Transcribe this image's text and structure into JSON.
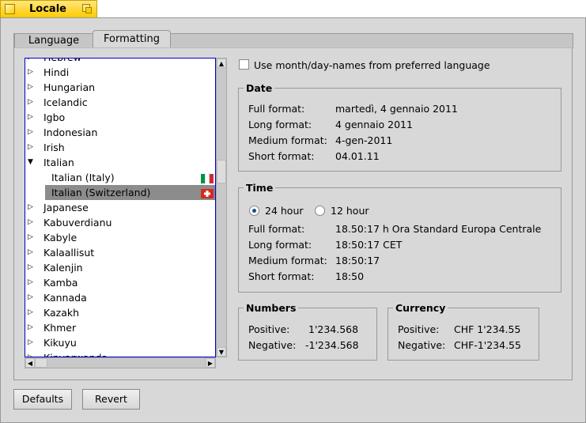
{
  "window": {
    "title": "Locale"
  },
  "tabs": [
    {
      "label": "Language"
    },
    {
      "label": "Formatting",
      "active": true
    }
  ],
  "language_list": [
    {
      "label": "Hebrew",
      "expanded": false
    },
    {
      "label": "Hindi",
      "expanded": false
    },
    {
      "label": "Hungarian",
      "expanded": false
    },
    {
      "label": "Icelandic",
      "expanded": false
    },
    {
      "label": "Igbo",
      "expanded": false
    },
    {
      "label": "Indonesian",
      "expanded": false
    },
    {
      "label": "Irish",
      "expanded": false
    },
    {
      "label": "Italian",
      "expanded": true
    },
    {
      "label": "Italian (Italy)",
      "child": true,
      "flag": "italy-flag"
    },
    {
      "label": "Italian (Switzerland)",
      "child": true,
      "flag": "switzerland-flag",
      "selected": true
    },
    {
      "label": "Japanese",
      "expanded": false
    },
    {
      "label": "Kabuverdianu",
      "expanded": false
    },
    {
      "label": "Kabyle",
      "expanded": false
    },
    {
      "label": "Kalaallisut",
      "expanded": false
    },
    {
      "label": "Kalenjin",
      "expanded": false
    },
    {
      "label": "Kamba",
      "expanded": false
    },
    {
      "label": "Kannada",
      "expanded": false
    },
    {
      "label": "Kazakh",
      "expanded": false
    },
    {
      "label": "Khmer",
      "expanded": false
    },
    {
      "label": "Kikuyu",
      "expanded": false
    },
    {
      "label": "Kinyarwanda",
      "expanded": false
    }
  ],
  "use_names_checkbox": {
    "label": "Use month/day-names from preferred language",
    "checked": false
  },
  "date": {
    "title": "Date",
    "rows": [
      {
        "label": "Full format:",
        "value": "martedì, 4 gennaio 2011"
      },
      {
        "label": "Long format:",
        "value": "4 gennaio 2011"
      },
      {
        "label": "Medium format:",
        "value": "4-gen-2011"
      },
      {
        "label": "Short format:",
        "value": "04.01.11"
      }
    ]
  },
  "time": {
    "title": "Time",
    "radio_24": "24 hour",
    "radio_12": "12 hour",
    "selected": "24 hour",
    "rows": [
      {
        "label": "Full format:",
        "value": "18.50:17 h Ora Standard Europa Centrale"
      },
      {
        "label": "Long format:",
        "value": "18:50:17 CET"
      },
      {
        "label": "Medium format:",
        "value": "18:50:17"
      },
      {
        "label": "Short format:",
        "value": "18:50"
      }
    ]
  },
  "numbers": {
    "title": "Numbers",
    "positive_label": "Positive:",
    "positive": "1'234.568",
    "negative_label": "Negative:",
    "negative": "-1'234.568"
  },
  "currency": {
    "title": "Currency",
    "positive_label": "Positive:",
    "positive": "CHF 1'234.55",
    "negative_label": "Negative:",
    "negative": "CHF-1'234.55"
  },
  "buttons": {
    "defaults": "Defaults",
    "revert": "Revert"
  },
  "colors": {
    "window_tab": "#ffcb00",
    "selection": "#8c8c8c",
    "list_focus": "#0000cc"
  }
}
